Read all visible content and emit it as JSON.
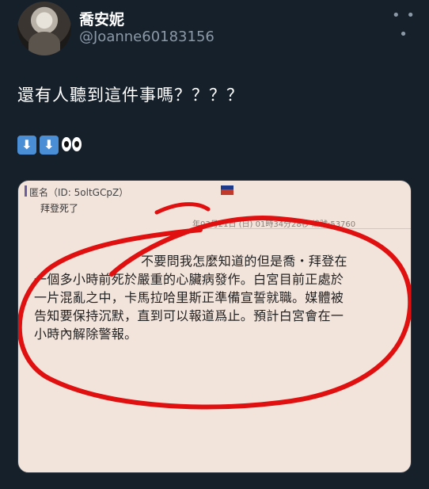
{
  "user": {
    "display_name": "喬安妮",
    "handle": "@Joanne60183156"
  },
  "tweet": {
    "text": "還有人聽到這件事嗎？？？？",
    "emojis": [
      "down-arrow-icon",
      "down-arrow-icon",
      "eyes-icon"
    ]
  },
  "screenshot": {
    "anon_header": "匿名（ID: 5oltGCpZ）",
    "subtitle": "拜登死了",
    "meta": "年03月21日 (日) 01時34分28秒 編號:53760",
    "body_lines": [
      "不要問我怎麼知道的但是喬・拜登在",
      "一個多小時前死於嚴重的心臟病發作。白宮目前正處於",
      "一片混亂之中，卡馬拉哈里斯正準備宣誓就職。媒體被",
      "告知要保持沉默，直到可以報道爲止。預計白宮會在一",
      "小時內解除警報。"
    ],
    "annotation_color": "#e01010"
  }
}
